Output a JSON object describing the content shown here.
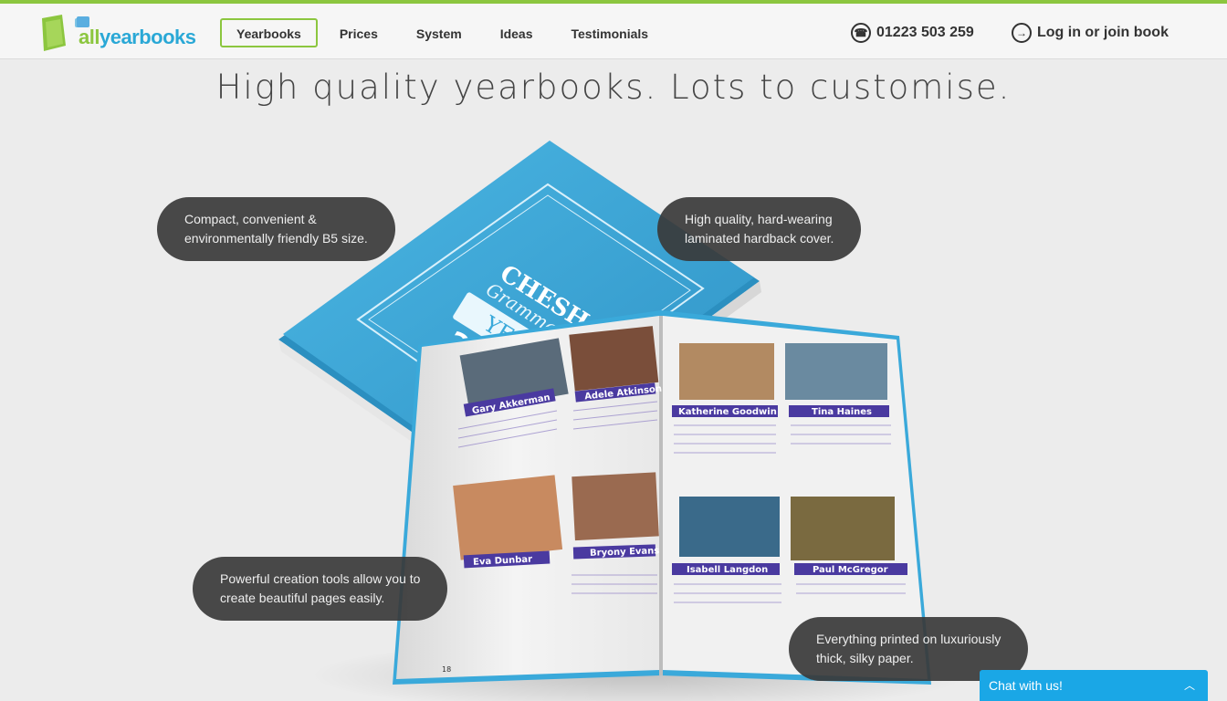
{
  "brand": {
    "logo_prefix": "all",
    "logo_suffix": "yearbooks"
  },
  "nav": [
    {
      "label": "Yearbooks",
      "active": true
    },
    {
      "label": "Prices"
    },
    {
      "label": "System"
    },
    {
      "label": "Ideas"
    },
    {
      "label": "Testimonials"
    }
  ],
  "contact": {
    "phone": "01223 503 259",
    "login": "Log in or join book"
  },
  "hero": {
    "headline": "High quality yearbooks. Lots to customise.",
    "callouts": {
      "size": [
        "Compact, convenient &",
        "environmentally friendly B5 size."
      ],
      "cover": [
        "High quality, hard-wearing",
        "laminated hardback cover."
      ],
      "tools": [
        "Powerful creation tools allow you to",
        "create beautiful pages easily."
      ],
      "paper": [
        "Everything printed on luxuriously",
        "thick, silky paper."
      ]
    },
    "book": {
      "cover_title": "CHESHAM",
      "cover_subtitle": "Grammar School",
      "cover_band": "YEARBO",
      "cover_year": "201",
      "students": [
        "Gary Akkerman",
        "Adele Atkinson",
        "Katherine Goodwin",
        "Tina Haines",
        "Eva Dunbar",
        "Bryony Evans",
        "Isabell Langdon",
        "Paul McGregor"
      ],
      "page_number": "18"
    }
  },
  "chat": {
    "label": "Chat with us!"
  },
  "colors": {
    "brand_green": "#8cc63f",
    "brand_blue": "#2aa8d6",
    "cover_blue": "#3aa9da",
    "chat_blue": "#1aa7e6",
    "name_banner": "#4a3aa0"
  }
}
